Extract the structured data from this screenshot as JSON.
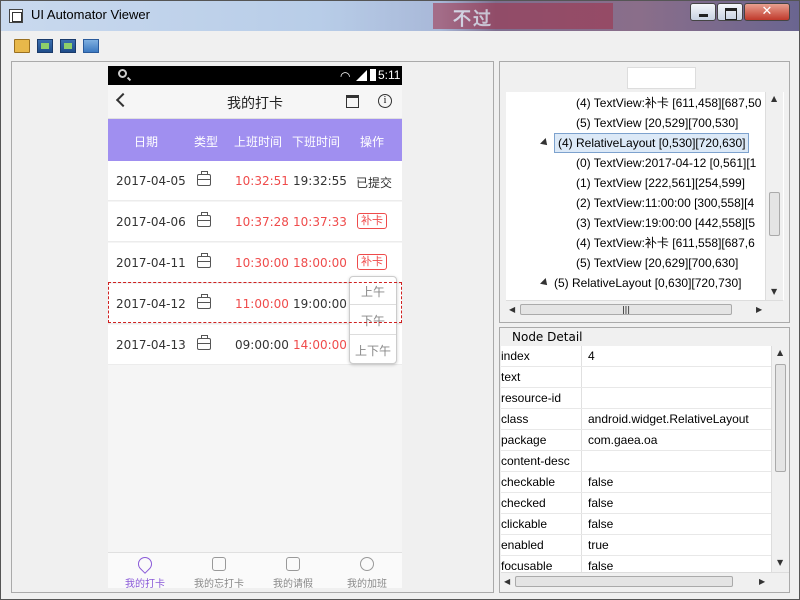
{
  "window": {
    "title": "UI Automator Viewer",
    "banner_text": "不过",
    "close_label": "✕"
  },
  "device": {
    "status": {
      "time": "5:11",
      "wifi": "wifi"
    },
    "app": {
      "title": "我的打卡",
      "columns": [
        "日期",
        "类型",
        "上班时间",
        "下班时间",
        "操作"
      ],
      "rows": [
        {
          "date": "2017-04-05",
          "in": "10:32:51",
          "out": "19:32:55",
          "action": "已提交",
          "in_red": true,
          "out_red": false,
          "action_pill": false
        },
        {
          "date": "2017-04-06",
          "in": "10:37:28",
          "out": "10:37:33",
          "action": "补卡",
          "in_red": true,
          "out_red": true,
          "action_pill": true
        },
        {
          "date": "2017-04-11",
          "in": "10:30:00",
          "out": "18:00:00",
          "action": "补卡",
          "in_red": true,
          "out_red": true,
          "action_pill": true
        },
        {
          "date": "2017-04-12",
          "in": "11:00:00",
          "out": "19:00:00",
          "action": "",
          "in_red": true,
          "out_red": false,
          "action_pill": false
        },
        {
          "date": "2017-04-13",
          "in": "09:00:00",
          "out": "14:00:00",
          "action": "",
          "in_red": false,
          "out_red": true,
          "action_pill": false
        }
      ],
      "popup": [
        "上午",
        "下午",
        "上下午"
      ],
      "nav": [
        "我的打卡",
        "我的忘打卡",
        "我的请假",
        "我的加班"
      ]
    }
  },
  "tree": {
    "search_value": "",
    "nodes": [
      {
        "label": "(4) TextView:补卡 [611,458][687,50",
        "expandable": false,
        "selected": false
      },
      {
        "label": "(5) TextView [20,529][700,530]",
        "expandable": false,
        "selected": false
      },
      {
        "label": "(4) RelativeLayout [0,530][720,630]",
        "expandable": true,
        "selected": true
      },
      {
        "label": "(0) TextView:2017-04-12 [0,561][1",
        "expandable": false,
        "selected": false
      },
      {
        "label": "(1) TextView [222,561][254,599]",
        "expandable": false,
        "selected": false
      },
      {
        "label": "(2) TextView:11:00:00 [300,558][4",
        "expandable": false,
        "selected": false
      },
      {
        "label": "(3) TextView:19:00:00 [442,558][5",
        "expandable": false,
        "selected": false
      },
      {
        "label": "(4) TextView:补卡 [611,558][687,6",
        "expandable": false,
        "selected": false
      },
      {
        "label": "(5) TextView [20,629][700,630]",
        "expandable": false,
        "selected": false
      },
      {
        "label": "(5) RelativeLayout [0,630][720,730]",
        "expandable": true,
        "selected": false
      }
    ],
    "h_scroll_label": "|||"
  },
  "detail": {
    "legend": "Node Detail",
    "rows": [
      {
        "key": "index",
        "value": "4"
      },
      {
        "key": "text",
        "value": ""
      },
      {
        "key": "resource-id",
        "value": ""
      },
      {
        "key": "class",
        "value": "android.widget.RelativeLayout"
      },
      {
        "key": "package",
        "value": "com.gaea.oa"
      },
      {
        "key": "content-desc",
        "value": ""
      },
      {
        "key": "checkable",
        "value": "false"
      },
      {
        "key": "checked",
        "value": "false"
      },
      {
        "key": "clickable",
        "value": "false"
      },
      {
        "key": "enabled",
        "value": "true"
      },
      {
        "key": "focusable",
        "value": "false"
      }
    ]
  },
  "colors": {
    "header_purple": "#a08ff0",
    "late_red": "#ef4b4b",
    "selection_red": "#d02020",
    "active_nav": "#8a5ad8"
  }
}
